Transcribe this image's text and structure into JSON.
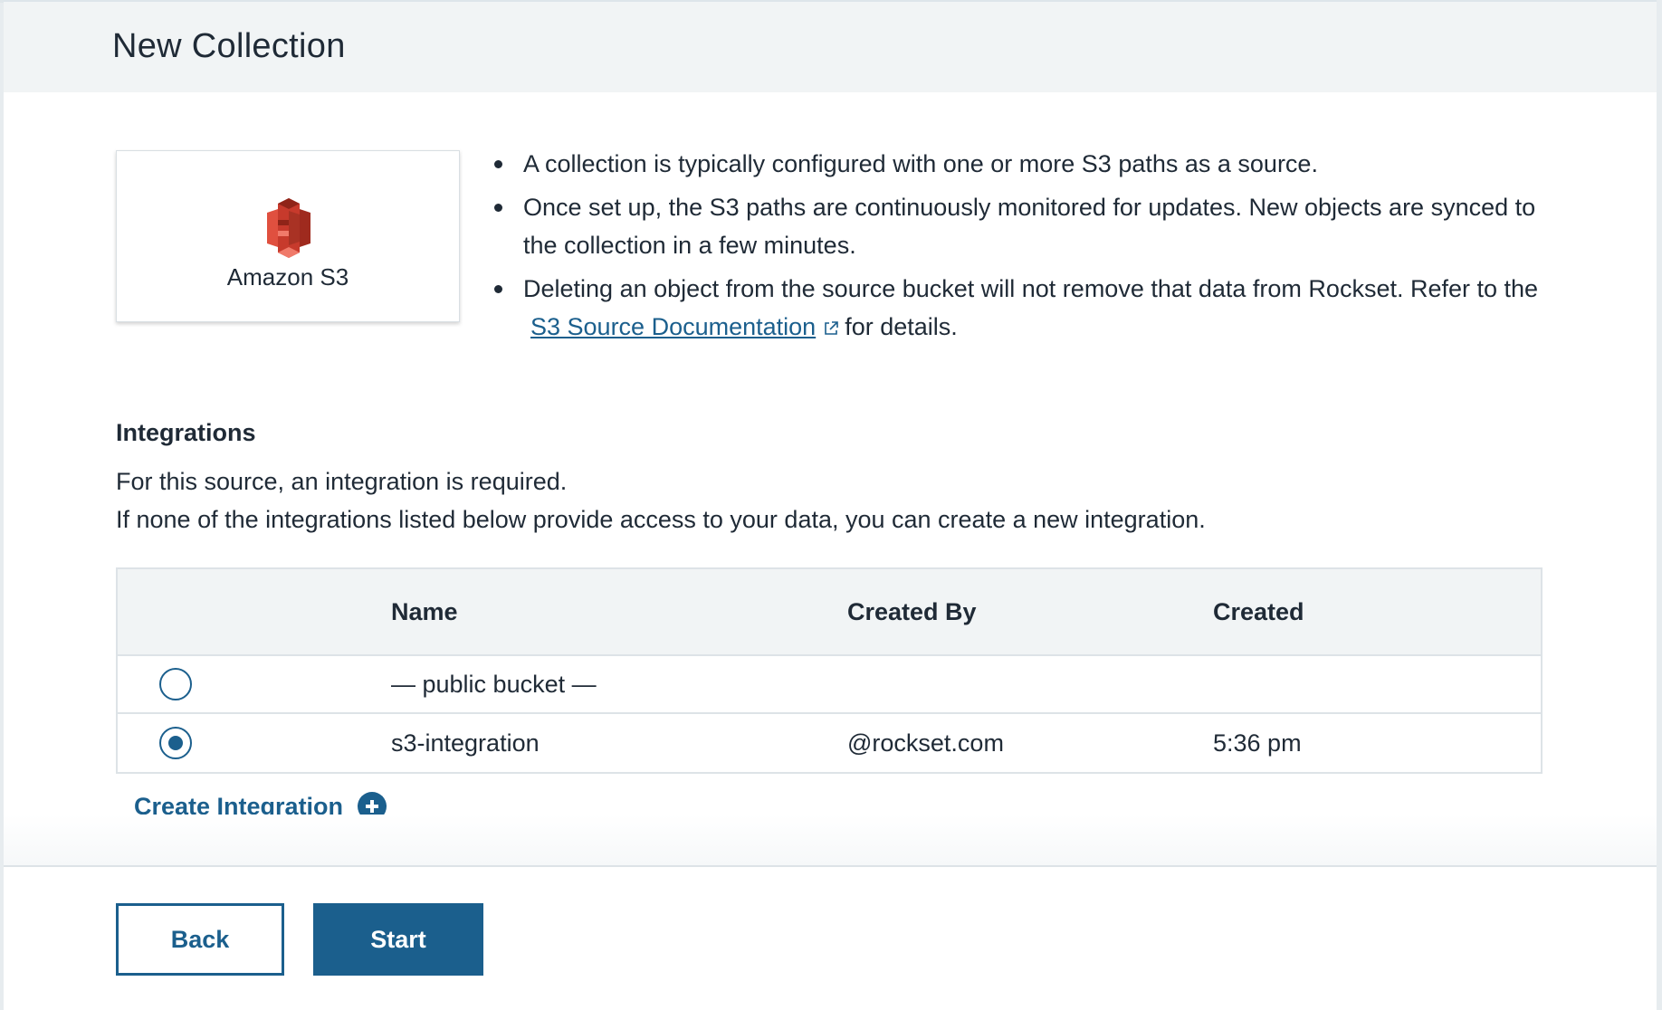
{
  "header": {
    "title": "New Collection"
  },
  "source": {
    "name": "Amazon S3",
    "logo_icon": "amazon-s3-logo",
    "logo_color": "#d93a2b"
  },
  "info": {
    "bullet1": "A collection is typically configured with one or more S3 paths as a source.",
    "bullet2": "Once set up, the S3 paths are continuously monitored for updates. New objects are synced to the collection in a few minutes.",
    "bullet3_text": "Deleting an object from the source bucket will not remove that data from Rockset. Refer to the",
    "bullet3_link": "S3 Source Documentation",
    "bullet3_suffix": "for details."
  },
  "integrations": {
    "title": "Integrations",
    "line1": "For this source, an integration is required.",
    "line2": "If none of the integrations listed below provide access to your data, you can create a new integration.",
    "columns": {
      "name": "Name",
      "created_by": "Created By",
      "created": "Created"
    },
    "rows": [
      {
        "name": "— public bucket —",
        "created_by": "",
        "created": "",
        "selected": false
      },
      {
        "name": "s3-integration",
        "created_by": "@rockset.com",
        "created": "5:36 pm",
        "selected": true
      }
    ],
    "create_label": "Create Integration"
  },
  "footer": {
    "back_label": "Back",
    "start_label": "Start"
  },
  "colors": {
    "accent": "#1b5f8d",
    "header_bg": "#f1f4f5"
  }
}
